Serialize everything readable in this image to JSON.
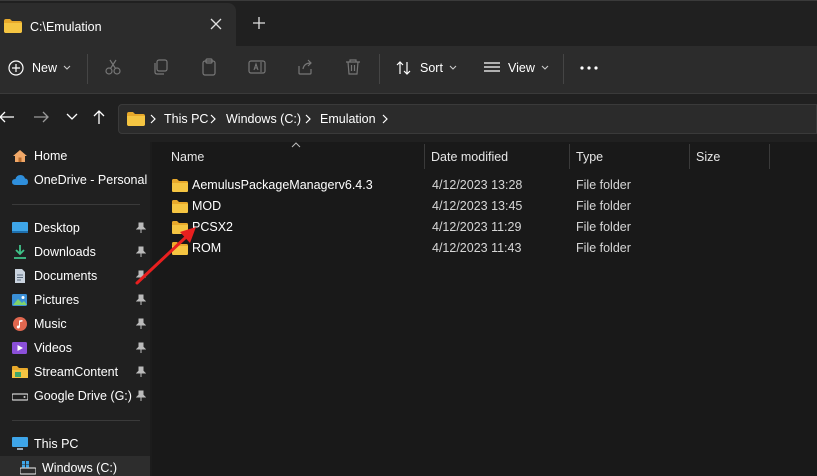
{
  "window": {
    "tab_title": "C:\\Emulation"
  },
  "toolbar": {
    "new_label": "New",
    "sort_label": "Sort",
    "view_label": "View"
  },
  "address": {
    "crumbs": [
      "This PC",
      "Windows (C:)",
      "Emulation"
    ]
  },
  "sidebar": {
    "items": [
      {
        "label": "Home",
        "icon": "home-icon"
      },
      {
        "label": "OneDrive - Personal",
        "icon": "onedrive-icon"
      },
      {
        "label": "Desktop",
        "icon": "desktop-icon",
        "pinned": true
      },
      {
        "label": "Downloads",
        "icon": "downloads-icon",
        "pinned": true
      },
      {
        "label": "Documents",
        "icon": "documents-icon",
        "pinned": true
      },
      {
        "label": "Pictures",
        "icon": "pictures-icon",
        "pinned": true
      },
      {
        "label": "Music",
        "icon": "music-icon",
        "pinned": true
      },
      {
        "label": "Videos",
        "icon": "videos-icon",
        "pinned": true
      },
      {
        "label": "StreamContent",
        "icon": "folder-icon",
        "pinned": true
      },
      {
        "label": "Google Drive (G:)",
        "icon": "drive-icon",
        "pinned": true
      },
      {
        "label": "This PC",
        "icon": "pc-icon"
      },
      {
        "label": "Windows (C:)",
        "icon": "drive-icon"
      }
    ]
  },
  "table": {
    "columns": [
      "Name",
      "Date modified",
      "Type",
      "Size"
    ],
    "rows": [
      {
        "name": "AemulusPackageManagerv6.4.3",
        "date": "4/12/2023 13:28",
        "type": "File folder",
        "size": ""
      },
      {
        "name": "MOD",
        "date": "4/12/2023 13:45",
        "type": "File folder",
        "size": ""
      },
      {
        "name": "PCSX2",
        "date": "4/12/2023 11:29",
        "type": "File folder",
        "size": ""
      },
      {
        "name": "ROM",
        "date": "4/12/2023 11:43",
        "type": "File folder",
        "size": ""
      }
    ]
  },
  "colors": {
    "folder": "#f5c542",
    "annotation_arrow": "#e81f1f",
    "accent": "#4cc2ff"
  }
}
